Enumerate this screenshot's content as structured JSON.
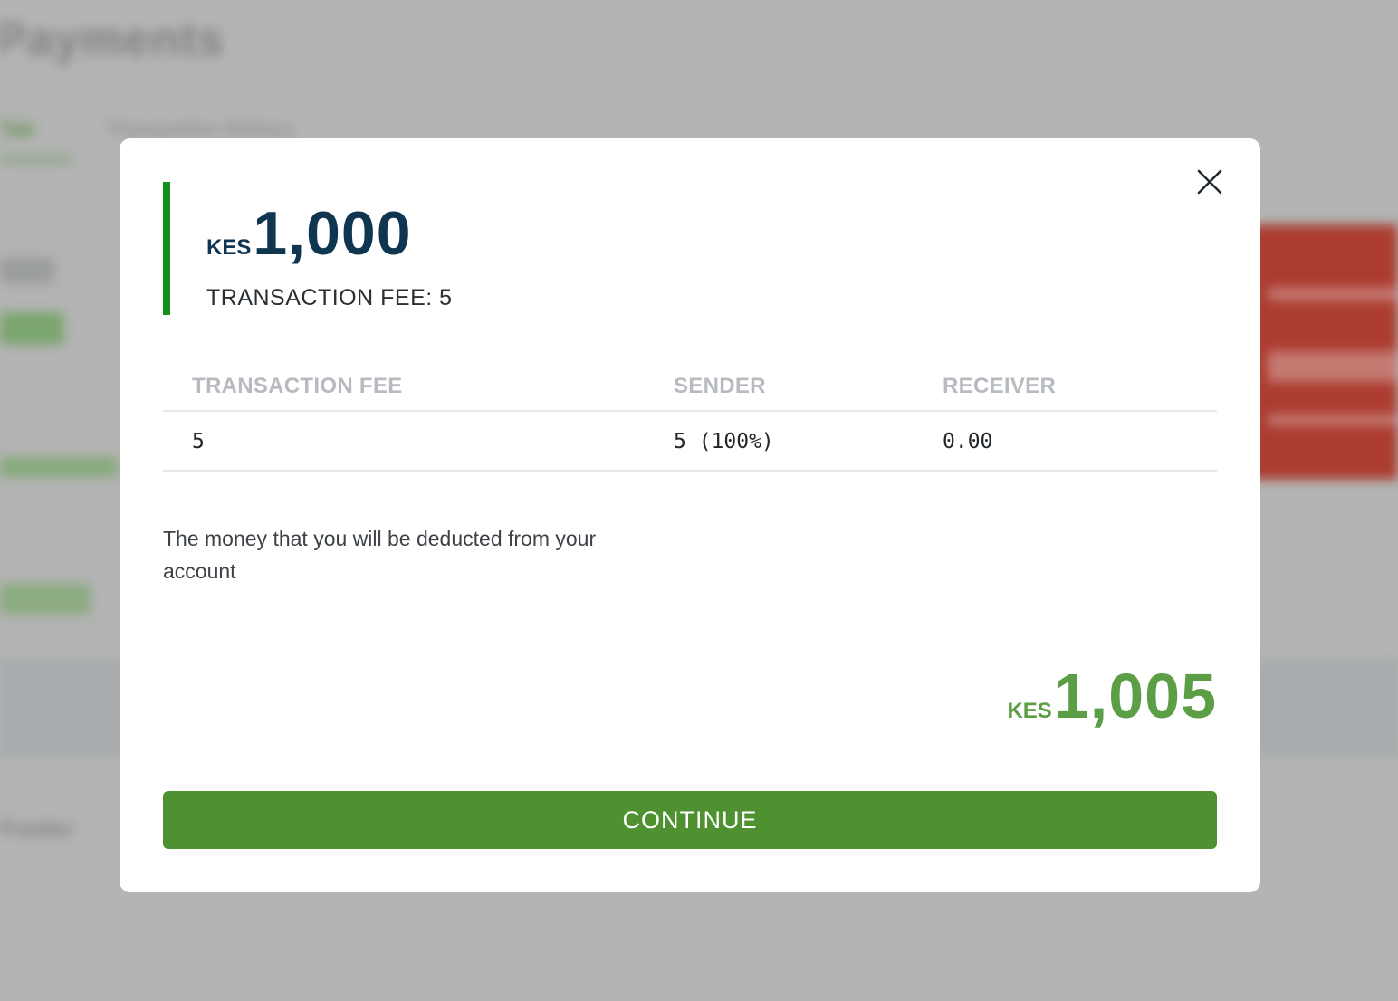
{
  "background": {
    "page_title": "Payments",
    "tabs": [
      "Tab",
      "Transaction History"
    ],
    "footer_text": "Footer"
  },
  "modal": {
    "amount": {
      "currency": "KES",
      "value": "1,000"
    },
    "fee_summary": "TRANSACTION FEE: 5",
    "table": {
      "headers": [
        "TRANSACTION FEE",
        "SENDER",
        "RECEIVER"
      ],
      "rows": [
        [
          "5",
          "5 (100%)",
          "0.00"
        ]
      ]
    },
    "deduction_note": "The money that you will be deducted from your account",
    "total": {
      "currency": "KES",
      "value": "1,005"
    },
    "continue_label": "CONTINUE",
    "close_icon": "close-icon"
  },
  "colors": {
    "accent_bar": "#13901a",
    "primary_text": "#0f3550",
    "total_green": "#5c9e45",
    "button_green": "#4f9131",
    "overlay": "#b3b4b3"
  }
}
